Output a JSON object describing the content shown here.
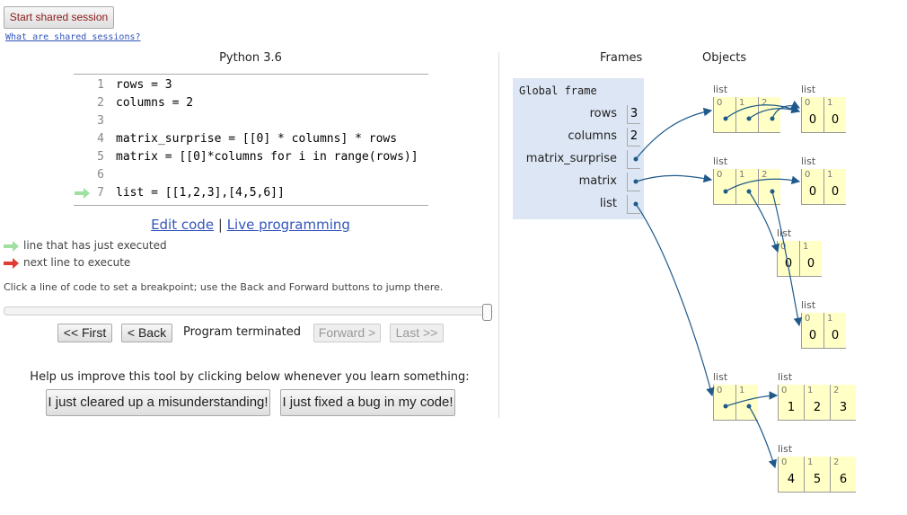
{
  "header": {
    "start_session_label": "Start shared session",
    "what_are_link": "What are shared sessions?"
  },
  "editor": {
    "title": "Python 3.6",
    "lines": [
      {
        "num": "1",
        "code": "rows = 3"
      },
      {
        "num": "2",
        "code": "columns = 2"
      },
      {
        "num": "3",
        "code": ""
      },
      {
        "num": "4",
        "code": "matrix_surprise = [[0] * columns] * rows"
      },
      {
        "num": "5",
        "code": "matrix = [[0]*columns for i in range(rows)]"
      },
      {
        "num": "6",
        "code": ""
      },
      {
        "num": "7",
        "code": "list = [[1,2,3],[4,5,6]]"
      }
    ],
    "edit_code_link": "Edit code",
    "separator": "|",
    "live_programming_link": "Live programming"
  },
  "legend": {
    "executed_label": "line that has just executed",
    "next_label": "next line to execute",
    "executed_color": "#a0e0a0",
    "next_color": "#e03c32"
  },
  "help_text": "Click a line of code to set a breakpoint; use the Back and Forward buttons to jump there.",
  "navigation": {
    "first_label": "<< First",
    "back_label": "< Back",
    "status": "Program terminated",
    "forward_label": "Forward >",
    "last_label": "Last >>"
  },
  "feedback": {
    "prompt": "Help us improve this tool by clicking below whenever you learn something:",
    "misunderstanding_label": "I just cleared up a misunderstanding!",
    "bug_label": "I just fixed a bug in my code!"
  },
  "visualizer": {
    "frames_title": "Frames",
    "objects_title": "Objects",
    "global_frame_label": "Global frame",
    "variables": [
      {
        "name": "rows",
        "value": "3"
      },
      {
        "name": "columns",
        "value": "2"
      },
      {
        "name": "matrix_surprise",
        "value": ""
      },
      {
        "name": "matrix",
        "value": ""
      },
      {
        "name": "list",
        "value": ""
      }
    ],
    "list_type_label": "list",
    "objects": [
      {
        "id": "ms_outer",
        "indices": [
          "0",
          "1",
          "2"
        ],
        "values": [
          "",
          "",
          ""
        ]
      },
      {
        "id": "ms_inner",
        "indices": [
          "0",
          "1"
        ],
        "values": [
          "0",
          "0"
        ]
      },
      {
        "id": "m_outer",
        "indices": [
          "0",
          "1",
          "2"
        ],
        "values": [
          "",
          "",
          ""
        ]
      },
      {
        "id": "m_row0",
        "indices": [
          "0",
          "1"
        ],
        "values": [
          "0",
          "0"
        ]
      },
      {
        "id": "m_row1",
        "indices": [
          "0",
          "1"
        ],
        "values": [
          "0",
          "0"
        ]
      },
      {
        "id": "m_row2",
        "indices": [
          "0",
          "1"
        ],
        "values": [
          "0",
          "0"
        ]
      },
      {
        "id": "l_outer",
        "indices": [
          "0",
          "1"
        ],
        "values": [
          "",
          ""
        ]
      },
      {
        "id": "l_row0",
        "indices": [
          "0",
          "1",
          "2"
        ],
        "values": [
          "1",
          "2",
          "3"
        ]
      },
      {
        "id": "l_row1",
        "indices": [
          "0",
          "1",
          "2"
        ],
        "values": [
          "4",
          "5",
          "6"
        ]
      }
    ],
    "frame_bg": "#dce6f4",
    "object_bg": "#ffffc6",
    "arrow_color": "#1f5a8a"
  }
}
